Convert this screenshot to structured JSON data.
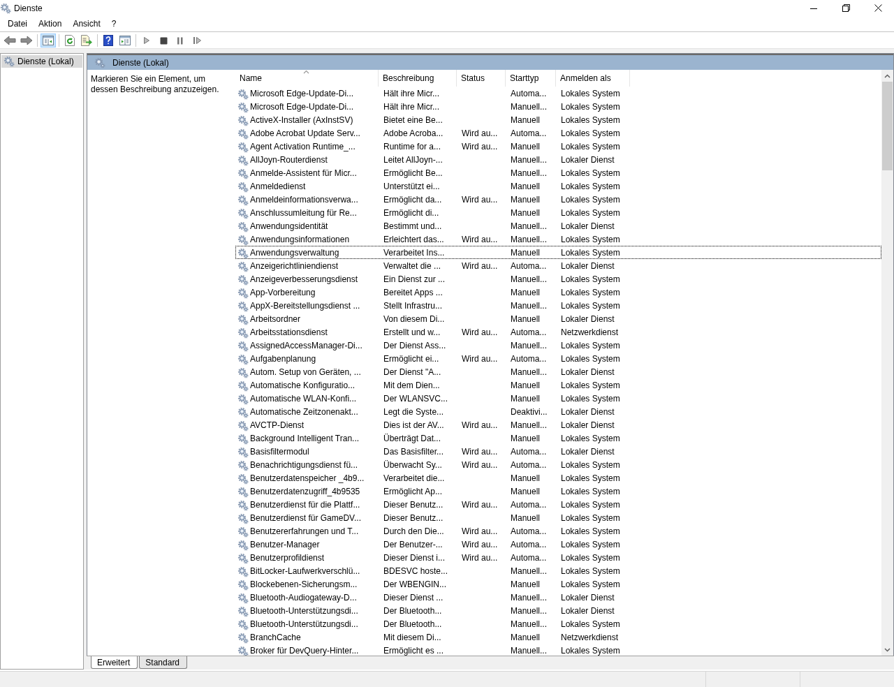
{
  "window": {
    "title": "Dienste"
  },
  "menu": [
    "Datei",
    "Aktion",
    "Ansicht",
    "?"
  ],
  "toolbar": {
    "tree_toggle_pressed": true
  },
  "tree": {
    "items": [
      {
        "label": "Dienste (Lokal)",
        "selected": true
      }
    ]
  },
  "pane": {
    "title": "Dienste (Lokal)",
    "hint": "Markieren Sie ein Element, um dessen Beschreibung anzuzeigen."
  },
  "table": {
    "columns": [
      {
        "label": "Name",
        "sorted": true
      },
      {
        "label": "Beschreibung",
        "sorted": false
      },
      {
        "label": "Status",
        "sorted": false
      },
      {
        "label": "Starttyp",
        "sorted": false
      },
      {
        "label": "Anmelden als",
        "sorted": false
      }
    ],
    "rows": [
      {
        "name": "Microsoft Edge-Update-Di...",
        "description": "Hält ihre Micr...",
        "startup": "Automa...",
        "logon_as": "Lokales System",
        "focused": false
      },
      {
        "name": "Microsoft Edge-Update-Di...",
        "description": "Hält ihre Micr...",
        "startup": "Manuell...",
        "logon_as": "Lokales System",
        "focused": false
      },
      {
        "name": "ActiveX-Installer (AxInstSV)",
        "description": "Bietet eine Be...",
        "startup": "Manuell",
        "logon_as": "Lokales System",
        "focused": false
      },
      {
        "name": "Adobe Acrobat Update Serv...",
        "description": "Adobe Acroba...",
        "status": "Wird au...",
        "startup": "Automa...",
        "logon_as": "Lokales System",
        "focused": false
      },
      {
        "name": "Agent Activation Runtime_...",
        "description": "Runtime for a...",
        "status": "Wird au...",
        "startup": "Manuell",
        "logon_as": "Lokales System",
        "focused": false
      },
      {
        "name": "AllJoyn-Routerdienst",
        "description": "Leitet AllJoyn-...",
        "startup": "Manuell...",
        "logon_as": "Lokaler Dienst",
        "focused": false
      },
      {
        "name": "Anmelde-Assistent für Micr...",
        "description": "Ermöglicht Be...",
        "startup": "Manuell...",
        "logon_as": "Lokales System",
        "focused": false
      },
      {
        "name": "Anmeldedienst",
        "description": "Unterstützt ei...",
        "startup": "Manuell",
        "logon_as": "Lokales System",
        "focused": false
      },
      {
        "name": "Anmeldeinformationsverwa...",
        "description": "Ermöglicht da...",
        "status": "Wird au...",
        "startup": "Manuell",
        "logon_as": "Lokales System",
        "focused": false
      },
      {
        "name": "Anschlussumleitung für Re...",
        "description": "Ermöglicht di...",
        "startup": "Manuell",
        "logon_as": "Lokales System",
        "focused": false
      },
      {
        "name": "Anwendungsidentität",
        "description": "Bestimmt und...",
        "startup": "Manuell...",
        "logon_as": "Lokaler Dienst",
        "focused": false
      },
      {
        "name": "Anwendungsinformationen",
        "description": "Erleichtert das...",
        "status": "Wird au...",
        "startup": "Manuell...",
        "logon_as": "Lokales System",
        "focused": false
      },
      {
        "name": "Anwendungsverwaltung",
        "description": "Verarbeitet Ins...",
        "startup": "Manuell",
        "logon_as": "Lokales System",
        "focused": true
      },
      {
        "name": "Anzeigerichtliniendienst",
        "description": "Verwaltet die ...",
        "status": "Wird au...",
        "startup": "Automa...",
        "logon_as": "Lokaler Dienst",
        "focused": false
      },
      {
        "name": "Anzeigeverbesserungsdienst",
        "description": "Ein Dienst zur ...",
        "startup": "Manuell...",
        "logon_as": "Lokales System",
        "focused": false
      },
      {
        "name": "App-Vorbereitung",
        "description": "Bereitet Apps ...",
        "startup": "Manuell",
        "logon_as": "Lokales System",
        "focused": false
      },
      {
        "name": "AppX-Bereitstellungsdienst ...",
        "description": "Stellt Infrastru...",
        "startup": "Manuell...",
        "logon_as": "Lokales System",
        "focused": false
      },
      {
        "name": "Arbeitsordner",
        "description": "Von diesem Di...",
        "startup": "Manuell",
        "logon_as": "Lokaler Dienst",
        "focused": false
      },
      {
        "name": "Arbeitsstationsdienst",
        "description": "Erstellt und w...",
        "status": "Wird au...",
        "startup": "Automa...",
        "logon_as": "Netzwerkdienst",
        "focused": false
      },
      {
        "name": "AssignedAccessManager-Di...",
        "description": "Der Dienst Ass...",
        "startup": "Manuell...",
        "logon_as": "Lokales System",
        "focused": false
      },
      {
        "name": "Aufgabenplanung",
        "description": "Ermöglicht ei...",
        "status": "Wird au...",
        "startup": "Automa...",
        "logon_as": "Lokales System",
        "focused": false
      },
      {
        "name": "Autom. Setup von Geräten, ...",
        "description": "Der Dienst \"A...",
        "startup": "Manuell...",
        "logon_as": "Lokaler Dienst",
        "focused": false
      },
      {
        "name": "Automatische Konfiguratio...",
        "description": "Mit dem Dien...",
        "startup": "Manuell",
        "logon_as": "Lokales System",
        "focused": false
      },
      {
        "name": "Automatische WLAN-Konfi...",
        "description": "Der WLANSVC...",
        "startup": "Manuell",
        "logon_as": "Lokales System",
        "focused": false
      },
      {
        "name": "Automatische Zeitzonenakt...",
        "description": "Legt die Syste...",
        "startup": "Deaktivi...",
        "logon_as": "Lokaler Dienst",
        "focused": false
      },
      {
        "name": "AVCTP-Dienst",
        "description": "Dies ist der AV...",
        "status": "Wird au...",
        "startup": "Manuell...",
        "logon_as": "Lokaler Dienst",
        "focused": false
      },
      {
        "name": "Background Intelligent Tran...",
        "description": "Überträgt Dat...",
        "startup": "Manuell",
        "logon_as": "Lokales System",
        "focused": false
      },
      {
        "name": "Basisfiltermodul",
        "description": "Das Basisfilter...",
        "status": "Wird au...",
        "startup": "Automa...",
        "logon_as": "Lokaler Dienst",
        "focused": false
      },
      {
        "name": "Benachrichtigungsdienst fü...",
        "description": "Überwacht Sy...",
        "status": "Wird au...",
        "startup": "Automa...",
        "logon_as": "Lokales System",
        "focused": false
      },
      {
        "name": "Benutzerdatenspeicher _4b9...",
        "description": "Verarbeitet die...",
        "startup": "Manuell",
        "logon_as": "Lokales System",
        "focused": false
      },
      {
        "name": "Benutzerdatenzugriff_4b9535",
        "description": "Ermöglicht Ap...",
        "startup": "Manuell",
        "logon_as": "Lokales System",
        "focused": false
      },
      {
        "name": "Benutzerdienst für die Plattf...",
        "description": "Dieser Benutz...",
        "status": "Wird au...",
        "startup": "Automa...",
        "logon_as": "Lokales System",
        "focused": false
      },
      {
        "name": "Benutzerdienst für GameDV...",
        "description": "Dieser Benutz...",
        "startup": "Manuell",
        "logon_as": "Lokales System",
        "focused": false
      },
      {
        "name": "Benutzererfahrungen und T...",
        "description": "Durch den Die...",
        "status": "Wird au...",
        "startup": "Automa...",
        "logon_as": "Lokales System",
        "focused": false
      },
      {
        "name": "Benutzer-Manager",
        "description": "Der Benutzer-...",
        "status": "Wird au...",
        "startup": "Automa...",
        "logon_as": "Lokales System",
        "focused": false
      },
      {
        "name": "Benutzerprofildienst",
        "description": "Dieser Dienst i...",
        "status": "Wird au...",
        "startup": "Automa...",
        "logon_as": "Lokales System",
        "focused": false
      },
      {
        "name": "BitLocker-Laufwerkverschlü...",
        "description": "BDESVC hoste...",
        "startup": "Manuell...",
        "logon_as": "Lokales System",
        "focused": false
      },
      {
        "name": "Blockebenen-Sicherungsm...",
        "description": "Der WBENGIN...",
        "startup": "Manuell",
        "logon_as": "Lokales System",
        "focused": false
      },
      {
        "name": "Bluetooth-Audiogateway-D...",
        "description": "Dieser Dienst ...",
        "startup": "Manuell...",
        "logon_as": "Lokaler Dienst",
        "focused": false
      },
      {
        "name": "Bluetooth-Unterstützungsdi...",
        "description": "Der Bluetooth...",
        "startup": "Manuell...",
        "logon_as": "Lokaler Dienst",
        "focused": false
      },
      {
        "name": "Bluetooth-Unterstützungsdi...",
        "description": "Der Bluetooth...",
        "startup": "Manuell...",
        "logon_as": "Lokales System",
        "focused": false
      },
      {
        "name": "BranchCache",
        "description": "Mit diesem Di...",
        "startup": "Manuell",
        "logon_as": "Netzwerkdienst",
        "focused": false
      },
      {
        "name": "Broker für DevQuery-Hinter...",
        "description": "Ermöglicht es ...",
        "startup": "Manuell...",
        "logon_as": "Lokales System",
        "focused": false
      }
    ]
  },
  "view_tabs": [
    {
      "label": "Erweitert",
      "selected": true
    },
    {
      "label": "Standard",
      "selected": false
    }
  ]
}
